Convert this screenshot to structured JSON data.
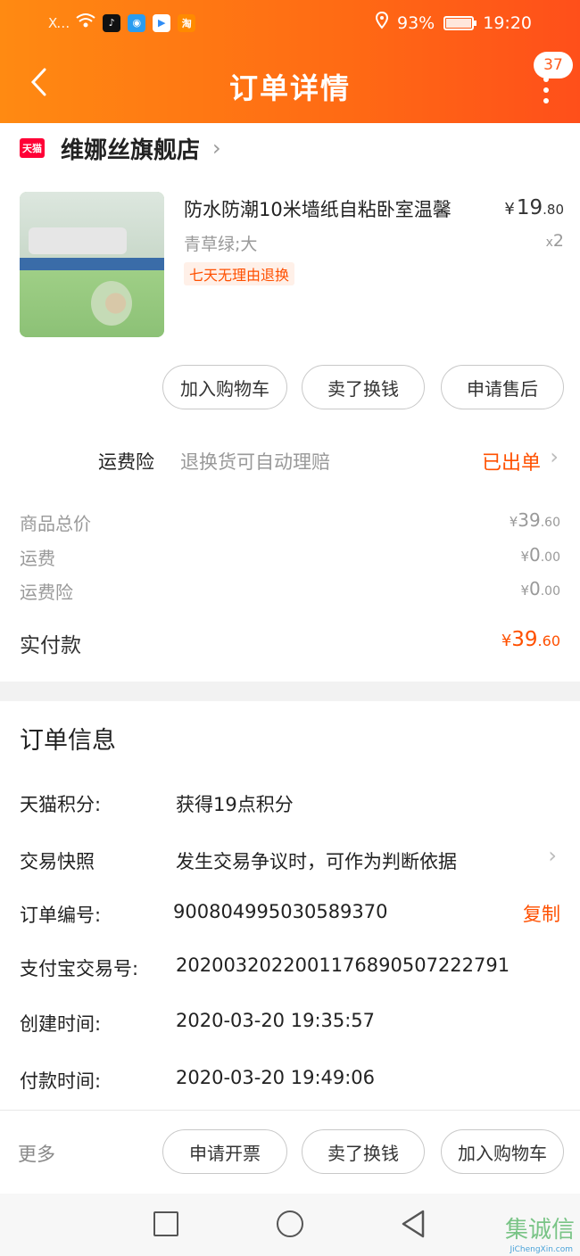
{
  "status_bar": {
    "signal": "X…",
    "battery_percent": "93%",
    "battery_level": 0.93,
    "time": "19:20",
    "app_icons": [
      "tiktok-icon",
      "lightbulb-icon",
      "youku-icon",
      "taobao-icon"
    ]
  },
  "nav": {
    "title": "订单详情",
    "badge_count": "37"
  },
  "shop": {
    "logo_text": "天猫",
    "name": "维娜丝旗舰店"
  },
  "product": {
    "title": "防水防潮10米墙纸自粘卧室温馨",
    "price_currency": "¥",
    "price_int": "19",
    "price_dec": ".80",
    "sku": "青草绿;大",
    "qty_x": "x",
    "qty": "2",
    "tag": "七天无理由退换",
    "actions": {
      "add_cart": "加入购物车",
      "resell": "卖了换钱",
      "after_sale": "申请售后"
    }
  },
  "insurance": {
    "label": "运费险",
    "desc": "退换货可自动理赔",
    "status": "已出单"
  },
  "prices": {
    "goods_total_label": "商品总价",
    "goods_total_cur": "¥",
    "goods_total_int": "39",
    "goods_total_dec": ".60",
    "freight_label": "运费",
    "freight_cur": "¥",
    "freight_int": "0",
    "freight_dec": ".00",
    "ins_fee_label": "运费险",
    "ins_fee_cur": "¥",
    "ins_fee_int": "0",
    "ins_fee_dec": ".00",
    "paid_label": "实付款",
    "paid_cur": "¥",
    "paid_int": "39",
    "paid_dec": ".60"
  },
  "order_info": {
    "title": "订单信息",
    "points_label": "天猫积分:",
    "points_value": "获得19点积分",
    "snapshot_label": "交易快照",
    "snapshot_value": "发生交易争议时，可作为判断依据",
    "order_no_label": "订单编号:",
    "order_no_value": "9008049950305893 70",
    "copy_label": "复制",
    "alipay_label": "支付宝交易号:",
    "alipay_value": "2020032022001176890507222791",
    "created_label": "创建时间:",
    "created_value": "2020-03-20 19:35:57",
    "paid_time_label": "付款时间:",
    "paid_time_value": "2020-03-20 19:49:06"
  },
  "bottom_bar": {
    "more": "更多",
    "invoice": "申请开票",
    "resell": "卖了换钱",
    "add_cart": "加入购物车"
  },
  "watermark": {
    "text": "集诚信",
    "sub": "JiChengXin.com"
  },
  "colors": {
    "accent": "#ff5000",
    "header_start": "#ff8a12",
    "header_end": "#ff4f1a",
    "tmall_red": "#ff0036"
  }
}
